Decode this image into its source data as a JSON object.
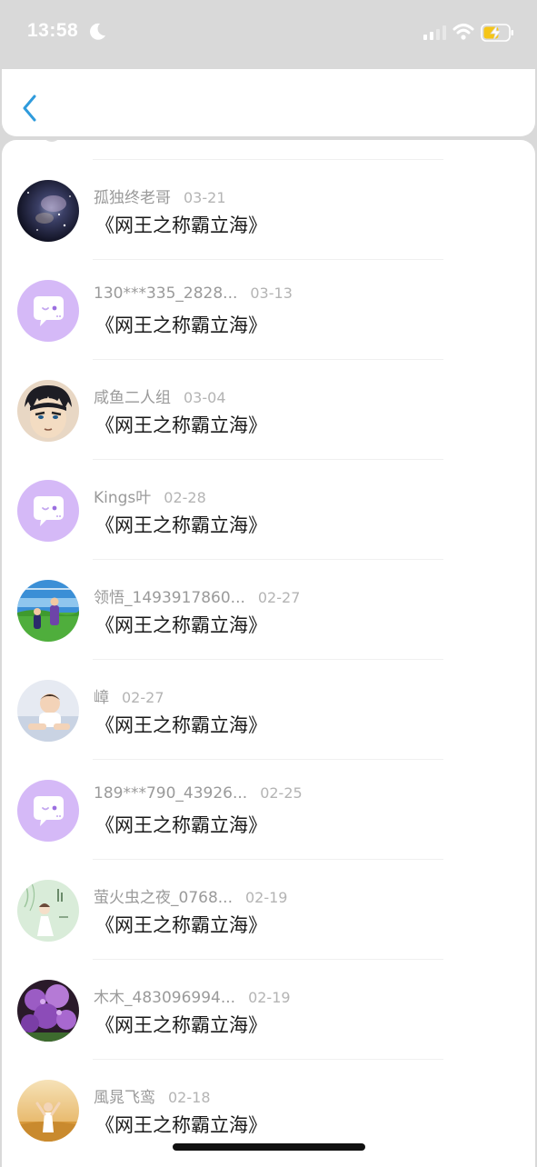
{
  "status_bar": {
    "time": "13:58"
  },
  "header": {
    "back_icon": "chevron-left-icon",
    "accent": "#2f9bdc"
  },
  "list": {
    "items": [
      {
        "name": "孤独终老哥",
        "date": "03-21",
        "title": "《网王之称霸立海》",
        "avatar": "galaxy"
      },
      {
        "name": "130***335_2828...",
        "date": "03-13",
        "title": "《网王之称霸立海》",
        "avatar": "default"
      },
      {
        "name": "咸鱼二人组",
        "date": "03-04",
        "title": "《网王之称霸立海》",
        "avatar": "anime"
      },
      {
        "name": "Kings叶",
        "date": "02-28",
        "title": "《网王之称霸立海》",
        "avatar": "default"
      },
      {
        "name": "领悟_1493917860...",
        "date": "02-27",
        "title": "《网王之称霸立海》",
        "avatar": "field"
      },
      {
        "name": "嶂",
        "date": "02-27",
        "title": "《网王之称霸立海》",
        "avatar": "baby"
      },
      {
        "name": "189***790_43926...",
        "date": "02-25",
        "title": "《网王之称霸立海》",
        "avatar": "default"
      },
      {
        "name": "萤火虫之夜_0768...",
        "date": "02-19",
        "title": "《网王之称霸立海》",
        "avatar": "illustration"
      },
      {
        "name": "木木_483096994...",
        "date": "02-19",
        "title": "《网王之称霸立海》",
        "avatar": "flowers"
      },
      {
        "name": "風晁飞鸾",
        "date": "02-18",
        "title": "《网王之称霸立海》",
        "avatar": "sunset"
      }
    ]
  }
}
